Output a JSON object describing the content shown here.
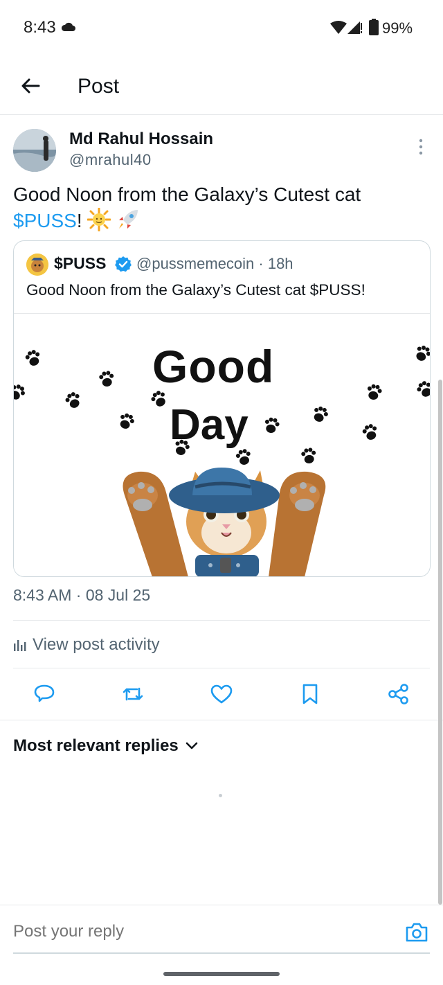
{
  "status_bar": {
    "time": "8:43",
    "battery": "99%"
  },
  "header": {
    "title": "Post"
  },
  "post": {
    "author_name": "Md Rahul Hossain",
    "author_handle": "@mrahul40",
    "text_before": "Good Noon from the Galaxy’s Cutest cat ",
    "cashtag": "$PUSS",
    "text_after": "!",
    "timestamp": "8:43 AM · 08 Jul 25"
  },
  "quote": {
    "name": "$PUSS",
    "handle_time": "@pussmemecoin · 18h",
    "text": "Good Noon from the Galaxy’s Cutest cat $PUSS!",
    "media_line1": "Good",
    "media_line2": "Day"
  },
  "activity": {
    "label": "View post activity"
  },
  "replies": {
    "sort_label": "Most relevant replies"
  },
  "reply_bar": {
    "placeholder": "Post your reply"
  },
  "colors": {
    "accent": "#1d9bf0",
    "text": "#0f1419",
    "muted": "#536471",
    "border": "#cfd9de"
  },
  "icons": [
    "cloud-icon",
    "wifi-icon",
    "signal-icon",
    "battery-icon",
    "back-arrow-icon",
    "more-vertical-icon",
    "verified-icon",
    "bar-chart-icon",
    "reply-icon",
    "repost-icon",
    "like-icon",
    "bookmark-icon",
    "share-icon",
    "chevron-down-icon",
    "camera-icon"
  ]
}
